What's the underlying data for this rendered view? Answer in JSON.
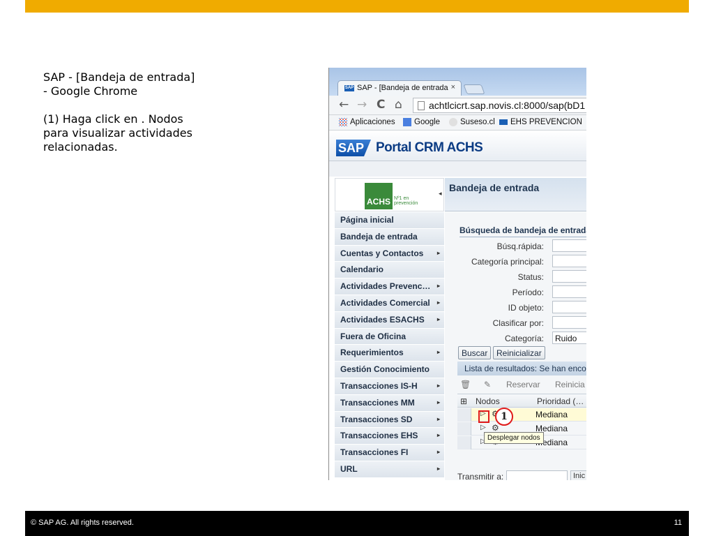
{
  "instructions": {
    "title_line1": "SAP - [Bandeja de entrada]",
    "title_line2": "- Google Chrome",
    "step_line1": "(1) Haga click en .  Nodos",
    "step_line2": "para visualizar actividades",
    "step_line3": "relacionadas."
  },
  "browser": {
    "tab_logo": "SAP",
    "tab_title": "SAP - [Bandeja de entrada",
    "tab_close": "×",
    "url": "achtlcicrt.sap.novis.cl:8000/sap(bD1",
    "nav_icons": {
      "back": "←",
      "forward": "→",
      "reload": "C",
      "home": "⌂"
    },
    "bookmarks": [
      {
        "label": "Aplicaciones"
      },
      {
        "label": "Google"
      },
      {
        "label": "Suseso.cl"
      },
      {
        "label": "EHS PREVENCION"
      }
    ]
  },
  "portal": {
    "logo": "SAP",
    "title": "Portal CRM ACHS",
    "achs_logo": "ACHS",
    "achs_sub_1": "Nº1 en",
    "achs_sub_2": "prevención",
    "collapse_icon": "◂",
    "nav_items": [
      {
        "label": "Página inicial",
        "arrow": ""
      },
      {
        "label": "Bandeja de entrada",
        "arrow": ""
      },
      {
        "label": "Cuentas y Contactos",
        "arrow": "▸"
      },
      {
        "label": "Calendario",
        "arrow": ""
      },
      {
        "label": "Actividades Prevenc…",
        "arrow": "▸"
      },
      {
        "label": "Actividades Comercial",
        "arrow": "▸"
      },
      {
        "label": "Actividades ESACHS",
        "arrow": "▸"
      },
      {
        "label": "Fuera de Oficina",
        "arrow": ""
      },
      {
        "label": "Requerimientos",
        "arrow": "▸"
      },
      {
        "label": "Gestión Conocimiento",
        "arrow": ""
      },
      {
        "label": "Transacciones IS-H",
        "arrow": "▸"
      },
      {
        "label": "Transacciones MM",
        "arrow": "▸"
      },
      {
        "label": "Transacciones SD",
        "arrow": "▸"
      },
      {
        "label": "Transacciones EHS",
        "arrow": "▸"
      },
      {
        "label": "Transacciones FI",
        "arrow": "▸"
      },
      {
        "label": "URL",
        "arrow": "▸"
      }
    ]
  },
  "content": {
    "header_title": "Bandeja de entrada",
    "search_title": "Búsqueda de bandeja de entrada",
    "fields": [
      {
        "label": "Búsq.rápida:",
        "value": ""
      },
      {
        "label": "Categoría principal:",
        "value": ""
      },
      {
        "label": "Status:",
        "value": ""
      },
      {
        "label": "Período:",
        "value": ""
      },
      {
        "label": "ID objeto:",
        "value": ""
      },
      {
        "label": "Clasificar por:",
        "value": ""
      },
      {
        "label": "Categoría:",
        "value": "Ruido"
      }
    ],
    "buttons": {
      "search": "Buscar",
      "reset": "Reinicializar"
    },
    "results_title": "Lista de resultados: Se han enco",
    "toolbar": {
      "delete_icon": "🗑",
      "edit_icon": "✎",
      "reserve": "Reservar",
      "reset": "Reinicia"
    },
    "columns": {
      "icon": "⊞",
      "nodes": "Nodos",
      "priority": "Prioridad (…"
    },
    "rows": [
      {
        "expand": "▷",
        "gear": "⚙",
        "priority": "Mediana"
      },
      {
        "expand": "▷",
        "gear": "⚙",
        "priority": "Mediana"
      },
      {
        "expand": "▷",
        "gear": "⚙",
        "priority": "Mediana"
      }
    ],
    "tooltip": "Desplegar nodos",
    "callout_number": "1",
    "transmit_label": "Transmitir a:",
    "transmit_button": "Inic"
  },
  "footer": {
    "copyright": "©  SAP AG. All rights reserved.",
    "page_number": "11"
  },
  "colors": {
    "accent_bar": "#f0ab00",
    "highlight_red": "#e01a1a",
    "footer_bg": "#000000"
  }
}
